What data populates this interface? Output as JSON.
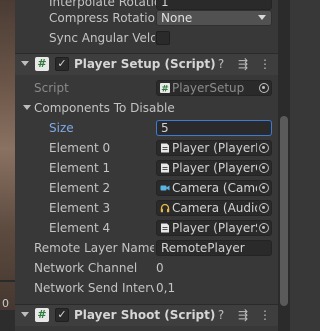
{
  "inspector": {
    "top_rows": {
      "interpolate_rotation": {
        "label": "Interpolate Rotatio",
        "value": "1"
      },
      "compress_rotation": {
        "label": "Compress Rotation",
        "value": "None"
      },
      "sync_angular_velocity": {
        "label": "Sync Angular Velo"
      }
    },
    "player_setup": {
      "icon": "#",
      "title": "Player Setup (Script)",
      "script_label": "Script",
      "script_value": "PlayerSetup",
      "components_to_disable": {
        "label": "Components To Disable",
        "size_label": "Size",
        "size_value": "5",
        "elements": [
          {
            "label": "Element 0",
            "value": "Player (PlayerM",
            "icon": "script-icon"
          },
          {
            "label": "Element 1",
            "value": "Player (PlayerC",
            "icon": "script-icon"
          },
          {
            "label": "Element 2",
            "value": "Camera (Came",
            "icon": "camera-icon"
          },
          {
            "label": "Element 3",
            "value": "Camera (Audio",
            "icon": "headphones-icon"
          },
          {
            "label": "Element 4",
            "value": "Player (PlayerS",
            "icon": "script-icon"
          }
        ]
      },
      "remote_layer_name": {
        "label": "Remote Layer Name",
        "value": "RemotePlayer"
      },
      "network_channel": {
        "label": "Network Channel",
        "value": "0"
      },
      "network_send_interval": {
        "label": "Network Send Interva",
        "value": "0,1"
      }
    },
    "player_shoot": {
      "icon": "#",
      "title": "Player Shoot (Script)"
    }
  },
  "scene_view": {
    "marker": "0"
  },
  "colors": {
    "panel_bg": "#383838",
    "header_bg": "#3e3e3e",
    "field_bg": "#2a2a2a",
    "focus_border": "#3e7bd6",
    "script_icon_green": "#2e7a3a",
    "size_label_blue": "#7fa9e6"
  }
}
